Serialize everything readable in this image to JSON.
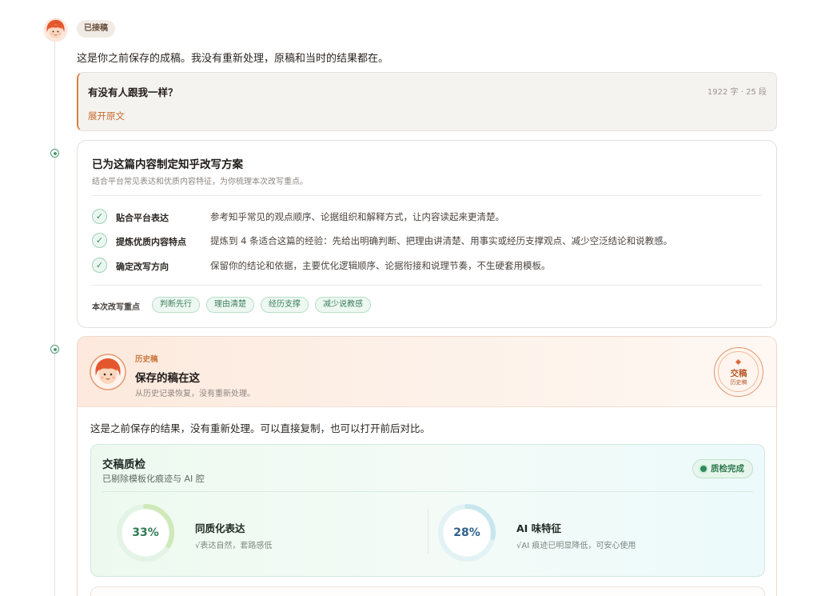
{
  "header": {
    "status_badge": "已接稿",
    "intro_text": "这是你之前保存的成稿。我没有重新处理，原稿和当时的结果都在。"
  },
  "draft": {
    "title": "有没有人跟我一样？",
    "meta": "1922 字 · 25 段",
    "expand_label": "展开原文"
  },
  "plan": {
    "title": "已为这篇内容制定知乎改写方案",
    "subtitle": "结合平台常见表达和优质内容特征，为你梳理本次改写重点。",
    "steps": [
      {
        "label": "贴合平台表达",
        "desc": "参考知乎常见的观点顺序、论据组织和解释方式，让内容读起来更清楚。"
      },
      {
        "label": "提炼优质内容特点",
        "desc": "提炼到 4 条适合这篇的经验：先给出明确判断、把理由讲清楚、用事实或经历支撑观点、减少空泛结论和说教感。"
      },
      {
        "label": "确定改写方向",
        "desc": "保留你的结论和依据，主要优化逻辑顺序、论据衔接和说理节奏，不生硬套用模板。"
      }
    ],
    "focus_label": "本次改写重点",
    "tags": [
      "判断先行",
      "理由清楚",
      "经历支撑",
      "减少说教感"
    ]
  },
  "history": {
    "tag": "历史稿",
    "title": "保存的稿在这",
    "subtitle": "从历史记录恢复，没有重新处理。",
    "stamp_main": "交稿",
    "stamp_small": "历史稿",
    "body_text": "这是之前保存的结果，没有重新处理。可以直接复制，也可以打开前后对比。"
  },
  "quality_check": {
    "title": "交稿质检",
    "subtitle": "已剔除模板化痕迹与 AI 腔",
    "badge": "质检完成",
    "metrics": [
      {
        "pct_label": "33%",
        "value": 0.33,
        "name": "同质化表达",
        "note": "√表达自然，套路感低",
        "color": "#2f7a55",
        "track": "#e3f3e6",
        "arc": "#cfe9b8"
      },
      {
        "pct_label": "28%",
        "value": 0.28,
        "name": "AI 味特征",
        "note": "√AI 痕迹已明显降低，可安心使用",
        "color": "#2f5f8a",
        "track": "#e3f2f5",
        "arc": "#c7e6ee"
      }
    ]
  },
  "colors": {
    "accent": "#c76a2e",
    "success": "#3e8d64"
  }
}
